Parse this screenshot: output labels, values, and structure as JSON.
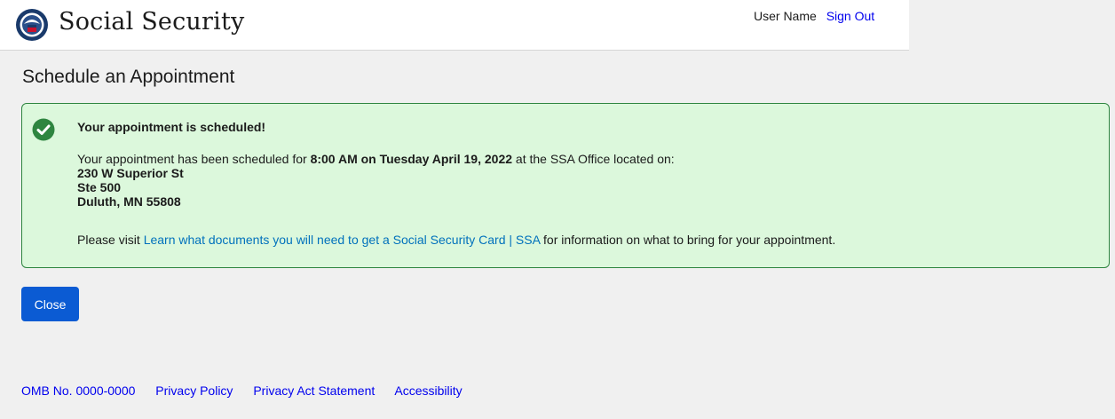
{
  "header": {
    "brand": "Social Security",
    "logo_icon": "ssa-seal-icon",
    "user_name": "User Name",
    "sign_out_label": "Sign Out"
  },
  "page": {
    "title": "Schedule an Appointment"
  },
  "alert": {
    "icon": "check-circle-icon",
    "heading": "Your appointment is scheduled!",
    "intro_before": "Your appointment has been scheduled for ",
    "datetime": "8:00 AM on Tuesday April 19, 2022",
    "intro_after": " at the SSA Office located on:",
    "address_line1": "230 W Superior St",
    "address_line2": "Ste 500",
    "address_line3": "Duluth, MN  55808",
    "visit_before": "Please visit ",
    "visit_link": "Learn what documents you will need to get a Social Security Card | SSA",
    "visit_after": "  for information on what to bring for your appointment."
  },
  "actions": {
    "close_label": "Close"
  },
  "footer": {
    "links": [
      "OMB No. 0000-0000",
      "Privacy Policy",
      "Privacy Act Statement",
      "Accessibility"
    ]
  },
  "colors": {
    "alert_background": "#dcf8dc",
    "alert_border": "#2e8540",
    "success_icon": "#2e8540",
    "primary_button": "#0b5bd3",
    "link": "#0000ee"
  }
}
